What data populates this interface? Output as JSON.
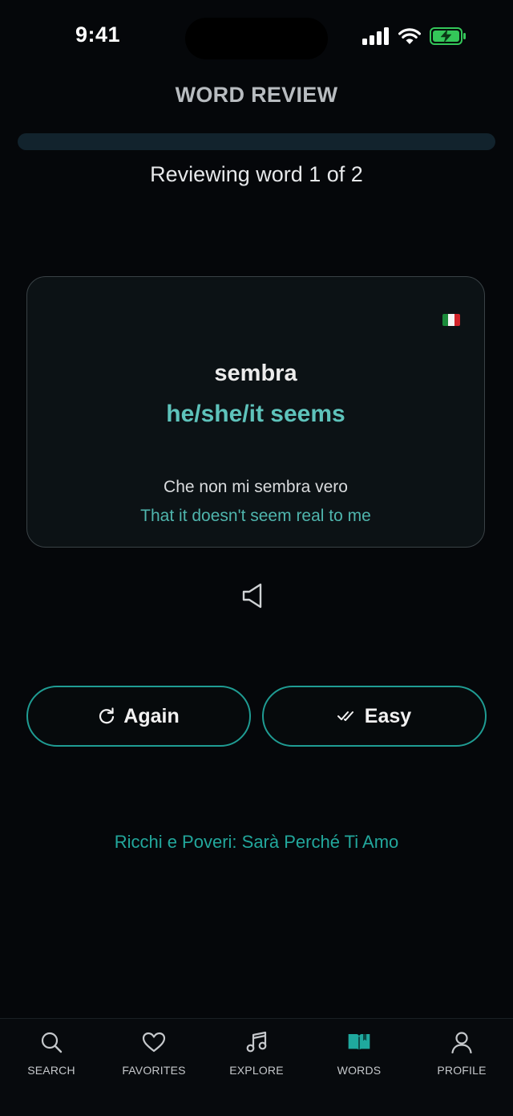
{
  "status_bar": {
    "time": "9:41",
    "battery_color": "#34c759"
  },
  "header": {
    "title": "WORD REVIEW",
    "progress_fraction": 0.0,
    "progress_text": "Reviewing word 1 of 2"
  },
  "card": {
    "language_flag": "italy-flag-icon",
    "word": "sembra",
    "translation": "he/she/it seems",
    "example": "Che non mi sembra vero",
    "example_translation": "That it doesn't seem real to me"
  },
  "audio": {
    "icon": "speaker-icon"
  },
  "actions": {
    "again_label": "Again",
    "again_icon": "refresh-icon",
    "easy_label": "Easy",
    "easy_icon": "double-check-icon"
  },
  "song": {
    "title": "Ricchi e Poveri: Sarà Perché Ti Amo"
  },
  "tabs": [
    {
      "label": "SEARCH",
      "icon": "search-icon",
      "active": false
    },
    {
      "label": "FAVORITES",
      "icon": "heart-icon",
      "active": false
    },
    {
      "label": "EXPLORE",
      "icon": "music-note-icon",
      "active": false
    },
    {
      "label": "WORDS",
      "icon": "book-icon",
      "active": true
    },
    {
      "label": "PROFILE",
      "icon": "user-icon",
      "active": false
    }
  ],
  "colors": {
    "accent": "#1f9c93",
    "translation": "#5ec3bb",
    "background": "#05070a"
  }
}
